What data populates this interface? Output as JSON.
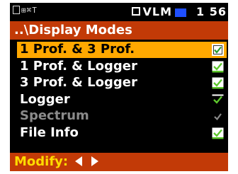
{
  "statusbar": {
    "left_text": "⊞⌘T",
    "mode": "VLM",
    "time": "1 56",
    "accent": "#1f4fff"
  },
  "title": "..\\Display Modes",
  "items": [
    {
      "label": "1 Prof. & 3 Prof.",
      "checked": true,
      "selected": true,
      "enabled": true
    },
    {
      "label": "1 Prof. & Logger",
      "checked": true,
      "selected": false,
      "enabled": true
    },
    {
      "label": "3 Prof. & Logger",
      "checked": true,
      "selected": false,
      "enabled": true
    },
    {
      "label": "Logger",
      "checked": true,
      "selected": false,
      "enabled": true
    },
    {
      "label": "Spectrum",
      "checked": true,
      "selected": false,
      "enabled": false
    },
    {
      "label": "File Info",
      "checked": true,
      "selected": false,
      "enabled": true
    }
  ],
  "footer": {
    "label": "Modify:",
    "left_icon": "left-arrow-icon",
    "right_icon": "right-arrow-icon"
  },
  "colors": {
    "title_bg": "#c23a07",
    "highlight": "#ffa800",
    "footer_text": "#ffdb00",
    "checkbox_green": "#5ec72d"
  }
}
